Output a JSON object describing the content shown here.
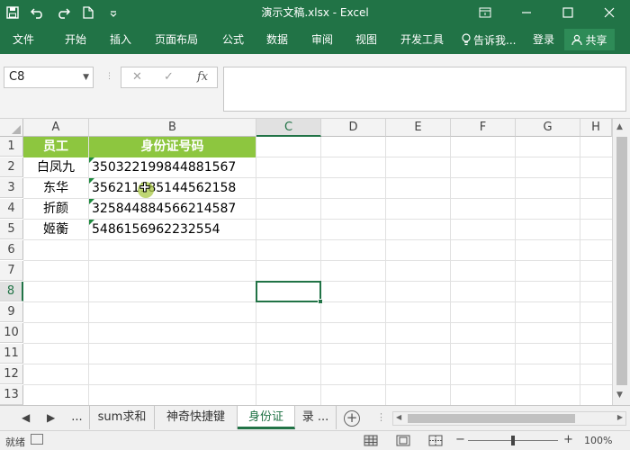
{
  "title": "演示文稿.xlsx - Excel",
  "ribbon_tabs": [
    "文件",
    "开始",
    "插入",
    "页面布局",
    "公式",
    "数据",
    "审阅",
    "视图",
    "开发工具"
  ],
  "tell_me": "告诉我...",
  "login": "登录",
  "share": "共享",
  "name_box": "C8",
  "fx_label": "fx",
  "columns": [
    "A",
    "B",
    "C",
    "D",
    "E",
    "F",
    "G",
    "H"
  ],
  "rows": [
    "1",
    "2",
    "3",
    "4",
    "5",
    "6",
    "7",
    "8",
    "9",
    "10",
    "11",
    "12",
    "13"
  ],
  "table": {
    "headers": [
      "员工",
      "身份证号码"
    ],
    "rows": [
      [
        "白凤九",
        "350322199844881567"
      ],
      [
        "东华",
        "356211185144562158"
      ],
      [
        "折颜",
        "325844884566214587"
      ],
      [
        "姬蘅",
        "5486156962232554"
      ]
    ]
  },
  "sheet_tabs": [
    "...",
    "sum求和",
    "神奇快捷键",
    "身份证",
    "录 ..."
  ],
  "active_sheet": "身份证",
  "status": {
    "ready": "就绪",
    "zoom": "100%"
  },
  "colors": {
    "excel_green": "#217346",
    "header_fill": "#8dc63f"
  }
}
